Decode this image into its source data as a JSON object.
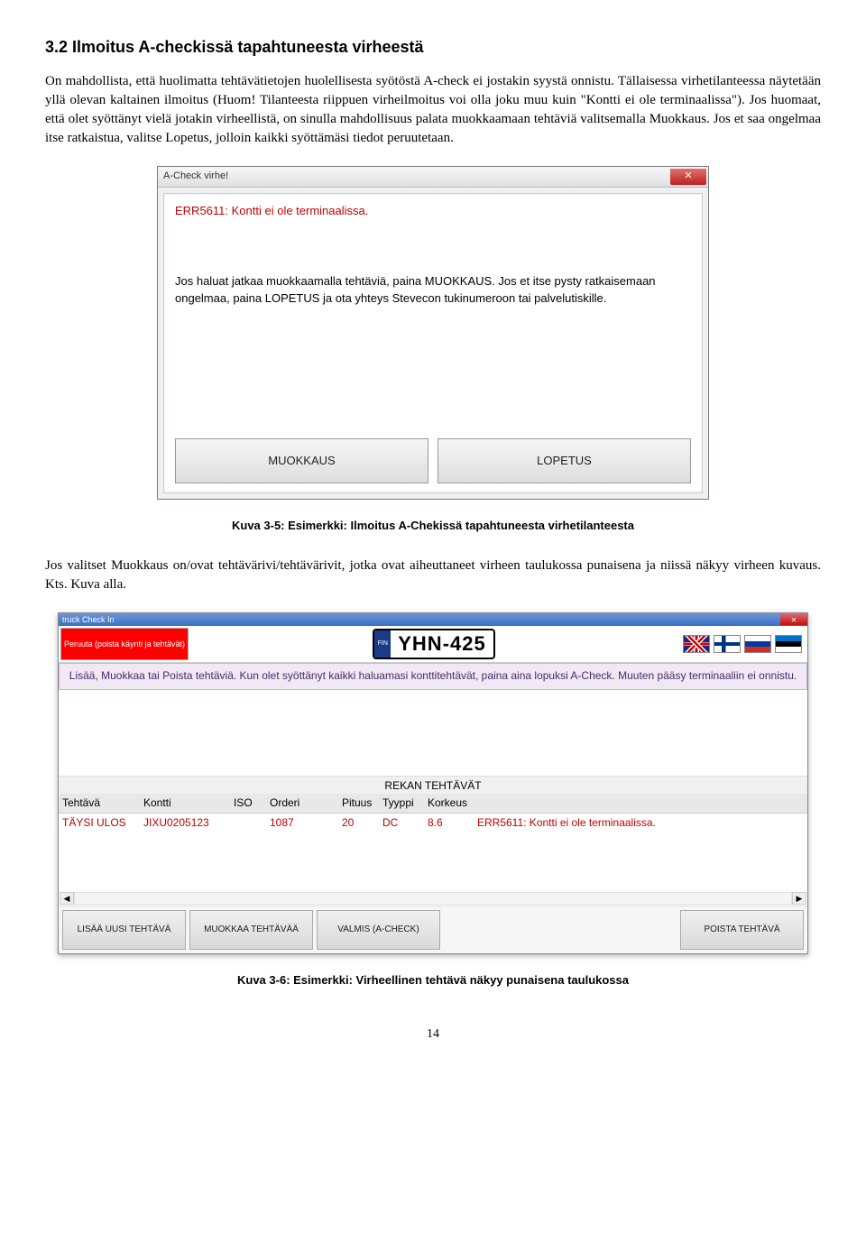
{
  "heading": "3.2 Ilmoitus A-checkissä tapahtuneesta virheestä",
  "paragraph1": "On mahdollista, että huolimatta tehtävätietojen huolellisesta syötöstä A-check ei jostakin syystä onnistu. Tällaisessa virhetilanteessa näytetään yllä olevan kaltainen ilmoitus (Huom! Tilanteesta riippuen virheilmoitus voi olla joku muu kuin \"Kontti ei ole terminaalissa\"). Jos huomaat, että olet syöttänyt vielä jotakin virheellistä, on sinulla mahdollisuus palata muokkaamaan tehtäviä valitsemalla Muokkaus. Jos et saa ongelmaa itse ratkaistua, valitse Lopetus, jolloin kaikki syöttämäsi tiedot peruutetaan.",
  "dialog": {
    "title": "A-Check virhe!",
    "close_x": "✕",
    "error_line": "ERR5611: Kontti ei ole terminaalissa.",
    "instruction": "Jos haluat jatkaa muokkaamalla tehtäviä, paina MUOKKAUS. Jos et itse pysty ratkaisemaan ongelmaa, paina LOPETUS ja ota yhteys Stevecon tukinumeroon tai palvelutiskille.",
    "btn_edit": "MUOKKAUS",
    "btn_quit": "LOPETUS"
  },
  "caption1": "Kuva 3-5: Esimerkki: Ilmoitus A-Chekissä tapahtuneesta virhetilanteesta",
  "paragraph2": "Jos valitset Muokkaus on/ovat tehtävärivi/tehtävärivit, jotka ovat aiheuttaneet virheen taulukossa punaisena ja niissä näkyy virheen kuvaus. Kts. Kuva alla.",
  "app": {
    "titlebar": "truck Check In",
    "close_x": "✕",
    "cancel": "Peruuta (poista käynti ja tehtävät)",
    "plate_country": "FIN",
    "plate": "YHN-425",
    "notice": "Lisää, Muokkaa tai Poista tehtäviä. Kun olet syöttänyt kaikki haluamasi konttitehtävät, paina aina lopuksi A-Check. Muuten pääsy terminaaliin ei onnistu.",
    "tasks_title": "REKAN TEHTÄVÄT",
    "headers": {
      "task": "Tehtävä",
      "kontti": "Kontti",
      "iso": "ISO",
      "orderi": "Orderi",
      "pituus": "Pituus",
      "tyyppi": "Tyyppi",
      "korkeus": "Korkeus"
    },
    "row": {
      "task": "TÄYSI ULOS",
      "kontti": "JIXU0205123",
      "iso": "",
      "orderi": "1087",
      "pituus": "20",
      "tyyppi": "DC",
      "korkeus": "8.6",
      "error": "ERR5611: Kontti ei ole terminaalissa."
    },
    "btn_add": "LISÄÄ UUSI TEHTÄVÄ",
    "btn_edit": "MUOKKAA TEHTÄVÄÄ",
    "btn_ready": "VALMIS (A-CHECK)",
    "btn_delete": "POISTA TEHTÄVÄ"
  },
  "caption2": "Kuva 3-6: Esimerkki: Virheellinen tehtävä näkyy punaisena taulukossa",
  "page_number": "14"
}
